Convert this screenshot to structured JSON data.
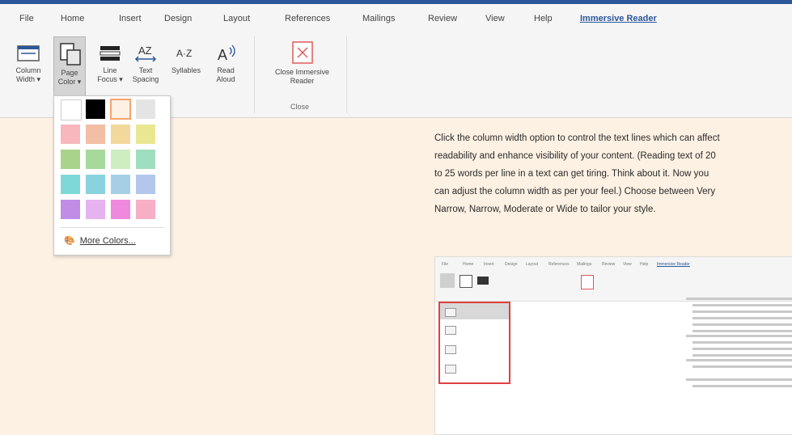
{
  "tabs": [
    "File",
    "Home",
    "Insert",
    "Design",
    "Layout",
    "References",
    "Mailings",
    "Review",
    "View",
    "Help",
    "Immersive Reader"
  ],
  "ribbon": {
    "column_width": {
      "line1": "Column",
      "line2": "Width ▾"
    },
    "page_color": {
      "line1": "Page",
      "line2": "Color ▾"
    },
    "line_focus": {
      "line1": "Line",
      "line2": "Focus ▾"
    },
    "text_spacing": {
      "line1": "Text",
      "line2": "Spacing"
    },
    "syllables": {
      "line1": "Syllables"
    },
    "read_aloud": {
      "line1": "Read",
      "line2": "Aloud"
    },
    "close": {
      "line1": "Close Immersive",
      "line2": "Reader"
    },
    "close_group": "Close"
  },
  "dropdown": {
    "swatches": [
      [
        "#ffffff",
        "#000000",
        "#fdf1e3",
        "#e4e4e4"
      ],
      [
        "#f7b7bd",
        "#f2bfa5",
        "#f3d89b",
        "#eae792"
      ],
      [
        "#a9d38a",
        "#a7d99b",
        "#cdeec1",
        "#9fdfbf"
      ],
      [
        "#7fd8d8",
        "#8bd2e0",
        "#a6cfe6",
        "#b3c7ec"
      ],
      [
        "#c18ce6",
        "#e6b3f0",
        "#ef88de",
        "#f7afc6"
      ]
    ],
    "more_colors": "More Colors..."
  },
  "doc": {
    "paragraph": "Click the column width option to control the text lines which can affect readability and enhance visibility of your content. (Reading text of 20 to 25 words per line in a text can get tiring. Think about it. Now you can adjust the column width as per your feel.) Choose between Very Narrow, Narrow, Moderate or Wide to tailor your style."
  },
  "colors": {
    "accent": "#2b579a",
    "page": "#fdf1e3",
    "highlight_red": "#e04040"
  }
}
